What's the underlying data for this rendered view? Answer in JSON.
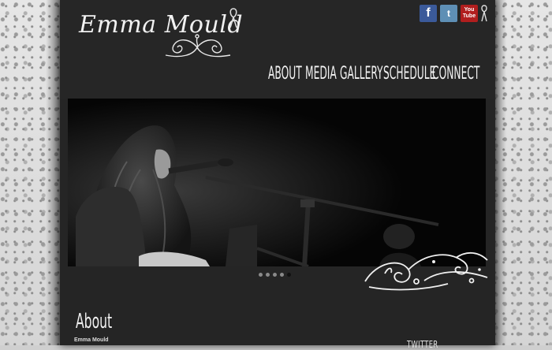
{
  "site": {
    "logo_text": "Emma Mould"
  },
  "social": [
    {
      "name": "Facebook",
      "glyph": "f",
      "color": "#3b5a9a"
    },
    {
      "name": "Twitter",
      "glyph": "t",
      "color": "#5e8fb5"
    },
    {
      "name": "YouTube",
      "glyph_top": "You",
      "glyph_bottom": "Tube",
      "color": "#b11e1e"
    }
  ],
  "nav": {
    "items": [
      "ABOUT",
      "MEDIA",
      "GALLERY",
      "SCHEDULE",
      "CONNECT"
    ]
  },
  "slider": {
    "dot_count": 5,
    "active_dot": 5
  },
  "about": {
    "title": "About",
    "subtitle": "Emma Mould"
  },
  "sidebar": {
    "twitter_title": "TWITTER"
  }
}
